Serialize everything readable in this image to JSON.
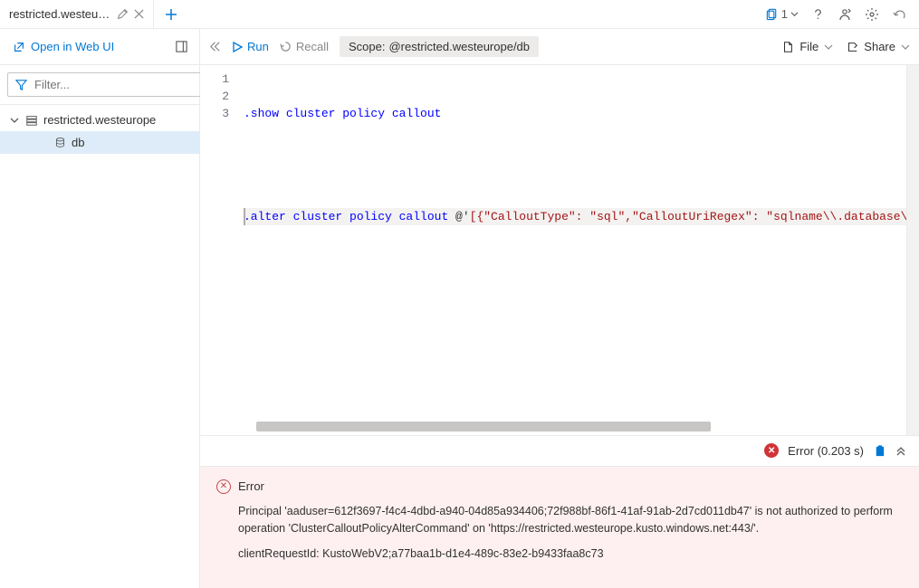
{
  "tabs": {
    "active_title": "restricted.westeur…"
  },
  "topright": {
    "copy_count": "1"
  },
  "toolbar": {
    "open_web_label": "Open in Web UI",
    "run_label": "Run",
    "recall_label": "Recall",
    "scope_label": "Scope:",
    "scope_value": "@restricted.westeurope/db",
    "file_label": "File",
    "share_label": "Share"
  },
  "sidebar": {
    "filter_placeholder": "Filter...",
    "cluster_name": "restricted.westeurope",
    "db_name": "db"
  },
  "editor": {
    "gutter": [
      "1",
      "2",
      "3"
    ],
    "line1_cmd": ".show",
    "line1_rest": " cluster policy callout",
    "line3_cmd": ".alter",
    "line3_kw": " cluster policy callout ",
    "line3_at": "@'",
    "line3_json": "[{\"CalloutType\": \"sql\",\"CalloutUriRegex\": \"sqlname\\\\.database\\"
  },
  "results": {
    "status_label": "Error",
    "timing": "(0.203 s)"
  },
  "error": {
    "heading": "Error",
    "message": "Principal 'aaduser=612f3697-f4c4-4dbd-a940-04d85a934406;72f988bf-86f1-41af-91ab-2d7cd011db47' is not authorized to perform operation 'ClusterCalloutPolicyAlterCommand' on 'https://restricted.westeurope.kusto.windows.net:443/'.",
    "request_id": "clientRequestId: KustoWebV2;a77baa1b-d1e4-489c-83e2-b9433faa8c73"
  }
}
